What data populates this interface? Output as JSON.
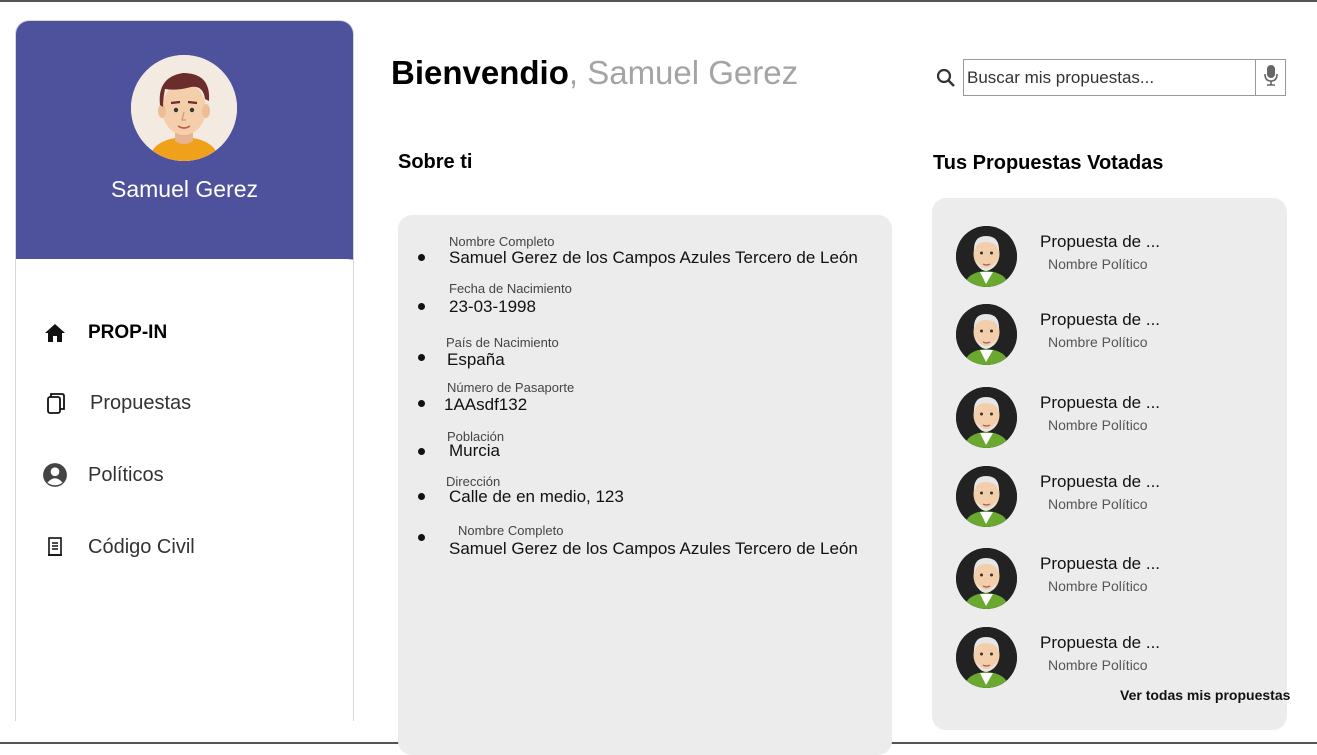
{
  "sidebar": {
    "user_name": "Samuel Gerez",
    "items": [
      {
        "label": "PROP-IN",
        "icon": "home-icon",
        "active": true
      },
      {
        "label": "Propuestas",
        "icon": "copy-icon",
        "active": false
      },
      {
        "label": "Políticos",
        "icon": "account-circle-icon",
        "active": false
      },
      {
        "label": "Código Civil",
        "icon": "document-icon",
        "active": false
      }
    ]
  },
  "header": {
    "greeting": "Bienvendio",
    "comma": ",",
    "name": "Samuel Gerez"
  },
  "search": {
    "placeholder": "Buscar mis propuestas...",
    "icon": "search-icon",
    "mic_icon": "microphone-icon"
  },
  "about": {
    "title": "Sobre ti",
    "fields": [
      {
        "label": "Nombre Completo",
        "value": "Samuel Gerez de los Campos Azules Tercero de León"
      },
      {
        "label": "Fecha de Nacimiento",
        "value": "23-03-1998"
      },
      {
        "label": "País de Nacimiento",
        "value": "España"
      },
      {
        "label": "Número de Pasaporte",
        "value": "1AAsdf132"
      },
      {
        "label": "Población",
        "value": "Murcia"
      },
      {
        "label": "Dirección",
        "value": "Calle de en medio, 123"
      },
      {
        "label": "Nombre Completo",
        "value": "Samuel Gerez de los Campos Azules Tercero de León"
      }
    ]
  },
  "voted": {
    "title": "Tus Propuestas Votadas",
    "items": [
      {
        "title": "Propuesta de ...",
        "politician": "Nombre Político"
      },
      {
        "title": "Propuesta de ...",
        "politician": "Nombre Político"
      },
      {
        "title": "Propuesta de ...",
        "politician": "Nombre Político"
      },
      {
        "title": "Propuesta de ...",
        "politician": "Nombre Político"
      },
      {
        "title": "Propuesta de ...",
        "politician": "Nombre Político"
      },
      {
        "title": "Propuesta de ...",
        "politician": "Nombre Político"
      }
    ],
    "see_all": "Ver todas mis propuestas"
  },
  "colors": {
    "sidebar_header": "#4e529c",
    "panel_bg": "#ececec",
    "muted_text": "#a4a4a4"
  }
}
